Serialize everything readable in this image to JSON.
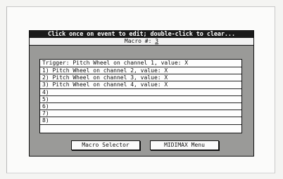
{
  "dialog": {
    "title": "Click once on event to edit; double-click to clear...",
    "macro_label": "Macro #: ",
    "macro_number": "3"
  },
  "events": {
    "trigger": "Trigger: Pitch Wheel on channel 1, value: X",
    "rows": [
      "1) Pitch Wheel on channel 2, value: X",
      "2) Pitch Wheel on channel 3, value: X",
      "3) Pitch Wheel on channel 4, value: X",
      "4)",
      "5)",
      "6)",
      "7)",
      "8)"
    ]
  },
  "buttons": {
    "selector": "Macro Selector",
    "menu": "MIDIMAX Menu"
  }
}
